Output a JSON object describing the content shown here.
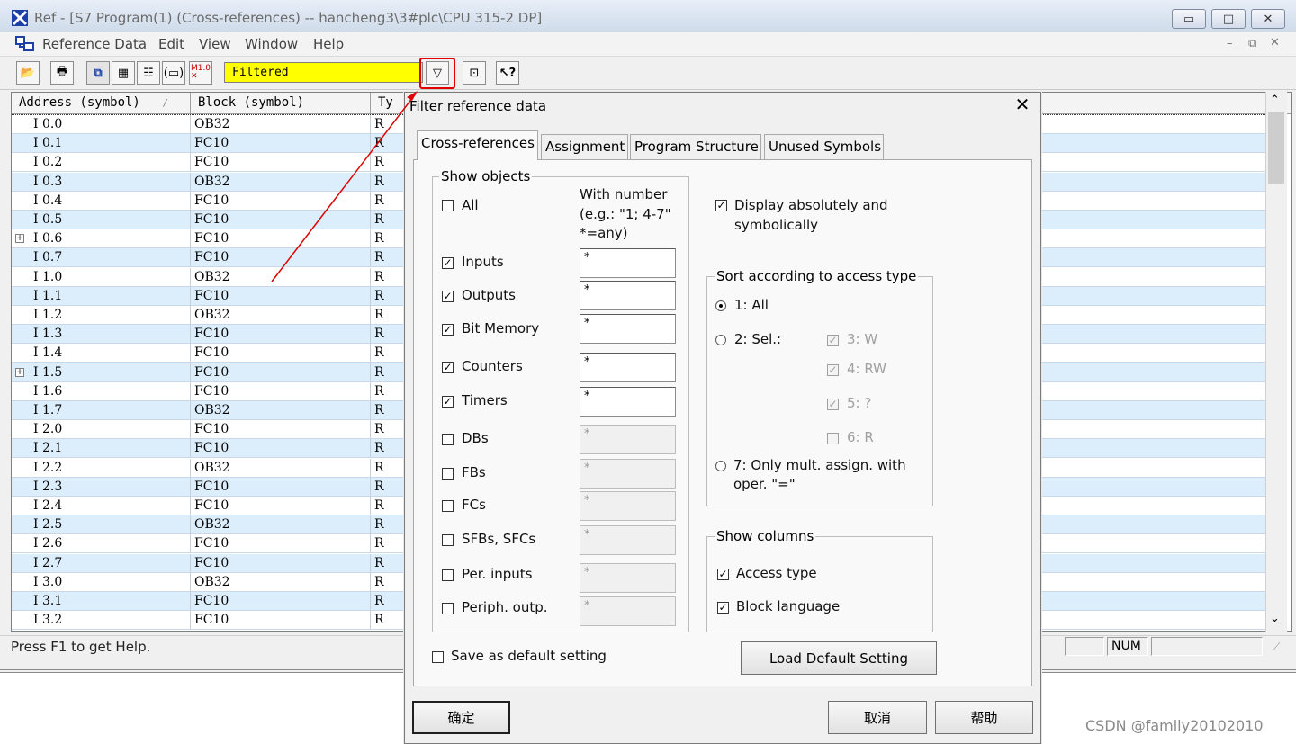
{
  "window": {
    "title": "Ref - [S7 Program(1) (Cross-references) -- hancheng3\\3#plc\\CPU 315-2 DP]"
  },
  "menu": [
    "Reference Data",
    "Edit",
    "View",
    "Window",
    "Help"
  ],
  "toolbar": {
    "filter_text": "Filtered",
    "icons": [
      "open-icon",
      "print-icon",
      "cross-references-icon",
      "assignment-icon",
      "program-structure-icon",
      "unused-symbols-icon",
      "addresses-without-symbols-icon",
      "filter-icon",
      "new-window-icon",
      "help-icon"
    ]
  },
  "table": {
    "headers": [
      "Address (symbol)",
      "Block (symbol)",
      "Ty"
    ],
    "rows": [
      {
        "addr": "I 0.0",
        "block": "OB32",
        "type": "R",
        "expand": false
      },
      {
        "addr": "I 0.1",
        "block": "FC10",
        "type": "R",
        "expand": false
      },
      {
        "addr": "I 0.2",
        "block": "FC10",
        "type": "R",
        "expand": false
      },
      {
        "addr": "I 0.3",
        "block": "OB32",
        "type": "R",
        "expand": false
      },
      {
        "addr": "I 0.4",
        "block": "FC10",
        "type": "R",
        "expand": false
      },
      {
        "addr": "I 0.5",
        "block": "FC10",
        "type": "R",
        "expand": false
      },
      {
        "addr": "I 0.6",
        "block": "FC10",
        "type": "R",
        "expand": true
      },
      {
        "addr": "I 0.7",
        "block": "FC10",
        "type": "R",
        "expand": false
      },
      {
        "addr": "I 1.0",
        "block": "OB32",
        "type": "R",
        "expand": false
      },
      {
        "addr": "I 1.1",
        "block": "FC10",
        "type": "R",
        "expand": false
      },
      {
        "addr": "I 1.2",
        "block": "OB32",
        "type": "R",
        "expand": false
      },
      {
        "addr": "I 1.3",
        "block": "FC10",
        "type": "R",
        "expand": false
      },
      {
        "addr": "I 1.4",
        "block": "FC10",
        "type": "R",
        "expand": false
      },
      {
        "addr": "I 1.5",
        "block": "FC10",
        "type": "R",
        "expand": true
      },
      {
        "addr": "I 1.6",
        "block": "FC10",
        "type": "R",
        "expand": false
      },
      {
        "addr": "I 1.7",
        "block": "OB32",
        "type": "R",
        "expand": false
      },
      {
        "addr": "I 2.0",
        "block": "FC10",
        "type": "R",
        "expand": false
      },
      {
        "addr": "I 2.1",
        "block": "FC10",
        "type": "R",
        "expand": false
      },
      {
        "addr": "I 2.2",
        "block": "OB32",
        "type": "R",
        "expand": false
      },
      {
        "addr": "I 2.3",
        "block": "FC10",
        "type": "R",
        "expand": false
      },
      {
        "addr": "I 2.4",
        "block": "FC10",
        "type": "R",
        "expand": false
      },
      {
        "addr": "I 2.5",
        "block": "OB32",
        "type": "R",
        "expand": false
      },
      {
        "addr": "I 2.6",
        "block": "FC10",
        "type": "R",
        "expand": false
      },
      {
        "addr": "I 2.7",
        "block": "FC10",
        "type": "R",
        "expand": false
      },
      {
        "addr": "I 3.0",
        "block": "OB32",
        "type": "R",
        "expand": false
      },
      {
        "addr": "I 3.1",
        "block": "FC10",
        "type": "R",
        "expand": false
      },
      {
        "addr": "I 3.2",
        "block": "FC10",
        "type": "R",
        "expand": false
      }
    ]
  },
  "status": {
    "help": "Press F1 to get Help.",
    "num": "NUM"
  },
  "dialog": {
    "title": "Filter reference data",
    "tabs": [
      "Cross-references",
      "Assignment",
      "Program Structure",
      "Unused Symbols"
    ],
    "show_objects": {
      "label": "Show objects",
      "with_number": "With number",
      "example": "(e.g.: \"1; 4-7\"",
      "any": "*=any)",
      "all_label": "All",
      "all_checked": false,
      "items": [
        {
          "label": "Inputs",
          "checked": true,
          "value": "*",
          "enabled": true
        },
        {
          "label": "Outputs",
          "checked": true,
          "value": "*",
          "enabled": true
        },
        {
          "label": "Bit Memory",
          "checked": true,
          "value": "*",
          "enabled": true
        },
        {
          "label": "Counters",
          "checked": true,
          "value": "*",
          "enabled": true
        },
        {
          "label": "Timers",
          "checked": true,
          "value": "*",
          "enabled": true
        },
        {
          "label": "DBs",
          "checked": false,
          "value": "*",
          "enabled": false
        },
        {
          "label": "FBs",
          "checked": false,
          "value": "*",
          "enabled": false
        },
        {
          "label": "FCs",
          "checked": false,
          "value": "*",
          "enabled": false
        },
        {
          "label": "SFBs, SFCs",
          "checked": false,
          "value": "*",
          "enabled": false
        },
        {
          "label": "Per. inputs",
          "checked": false,
          "value": "*",
          "enabled": false
        },
        {
          "label": "Periph. outp.",
          "checked": false,
          "value": "*",
          "enabled": false
        }
      ]
    },
    "display_abs_line1": "Display absolutely and",
    "display_abs_line2": "symbolically",
    "display_abs_checked": true,
    "sort": {
      "label": "Sort according to access type",
      "opt_all": "1: All",
      "opt_sel": "2: Sel.:",
      "sub": [
        "3: W",
        "4: RW",
        "5: ?",
        "6: R"
      ],
      "sub_checked": [
        true,
        true,
        true,
        false
      ],
      "opt_mult_line1": "7: Only mult. assign. with",
      "opt_mult_line2": "oper. \"=\"",
      "selected": "1: All"
    },
    "columns": {
      "label": "Show columns",
      "access_type": "Access type",
      "block_language": "Block language",
      "access_checked": true,
      "block_checked": true
    },
    "save_default": "Save as default setting",
    "load_default": "Load Default Setting",
    "ok": "确定",
    "cancel": "取消",
    "help": "帮助"
  },
  "watermark": "CSDN @family20102010",
  "colors": {
    "filter_bg": "#ffff00",
    "row_alt": "#dceefb",
    "annotation": "#e00000"
  }
}
